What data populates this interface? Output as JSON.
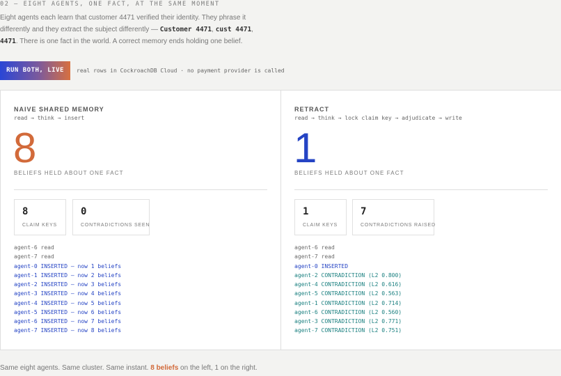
{
  "eyebrow": "02 — EIGHT AGENTS, ONE FACT, AT THE SAME MOMENT",
  "intro": {
    "text1": "Eight agents each learn that customer 4471 verified their identity. They phrase it differently and they extract the subject differently — ",
    "code1": "Customer 4471",
    "sep1": ", ",
    "code2": "cust 4471",
    "sep2": ", ",
    "code3": "4471",
    "text2": ". There is one fact in the world. A correct memory ends holding one belief."
  },
  "run_button": "RUN BOTH, LIVE",
  "run_note": "real rows in CockroachDB Cloud · no payment provider is called",
  "colors": {
    "orange": "#d26a3a",
    "blue": "#2544c4",
    "teal": "#1b8080"
  },
  "left": {
    "title": "NAIVE SHARED MEMORY",
    "subtitle": "read → think → insert",
    "big_number": "8",
    "big_label": "BELIEFS HELD ABOUT ONE FACT",
    "stats": [
      {
        "value": "8",
        "label": "CLAIM KEYS"
      },
      {
        "value": "0",
        "label": "CONTRADICTIONS SEEN"
      }
    ],
    "log": [
      {
        "kind": "read",
        "text": "agent-6 read"
      },
      {
        "kind": "read",
        "text": "agent-7 read"
      },
      {
        "kind": "insert",
        "text": "agent-0 INSERTED — now 1 beliefs"
      },
      {
        "kind": "insert",
        "text": "agent-1 INSERTED — now 2 beliefs"
      },
      {
        "kind": "insert",
        "text": "agent-2 INSERTED — now 3 beliefs"
      },
      {
        "kind": "insert",
        "text": "agent-3 INSERTED — now 4 beliefs"
      },
      {
        "kind": "insert",
        "text": "agent-4 INSERTED — now 5 beliefs"
      },
      {
        "kind": "insert",
        "text": "agent-5 INSERTED — now 6 beliefs"
      },
      {
        "kind": "insert",
        "text": "agent-6 INSERTED — now 7 beliefs"
      },
      {
        "kind": "insert",
        "text": "agent-7 INSERTED — now 8 beliefs"
      }
    ]
  },
  "right": {
    "title": "RETRACT",
    "subtitle": "read → think → lock claim key → adjudicate → write",
    "big_number": "1",
    "big_label": "BELIEFS HELD ABOUT ONE FACT",
    "stats": [
      {
        "value": "1",
        "label": "CLAIM KEYS"
      },
      {
        "value": "7",
        "label": "CONTRADICTIONS RAISED"
      }
    ],
    "log": [
      {
        "kind": "read",
        "text": "agent-6 read"
      },
      {
        "kind": "read",
        "text": "agent-7 read"
      },
      {
        "kind": "insert",
        "text": "agent-0 INSERTED"
      },
      {
        "kind": "contra",
        "text": "agent-2 CONTRADICTION (L2 0.800)"
      },
      {
        "kind": "contra",
        "text": "agent-4 CONTRADICTION (L2 0.616)"
      },
      {
        "kind": "contra",
        "text": "agent-5 CONTRADICTION (L2 0.563)"
      },
      {
        "kind": "contra",
        "text": "agent-1 CONTRADICTION (L2 0.714)"
      },
      {
        "kind": "contra",
        "text": "agent-6 CONTRADICTION (L2 0.560)"
      },
      {
        "kind": "contra",
        "text": "agent-3 CONTRADICTION (L2 0.771)"
      },
      {
        "kind": "contra",
        "text": "agent-7 CONTRADICTION (L2 0.751)"
      }
    ]
  },
  "footer": {
    "before": "Same eight agents. Same cluster. Same instant. ",
    "highlight": "8 beliefs",
    "after": " on the left, 1 on the right."
  }
}
